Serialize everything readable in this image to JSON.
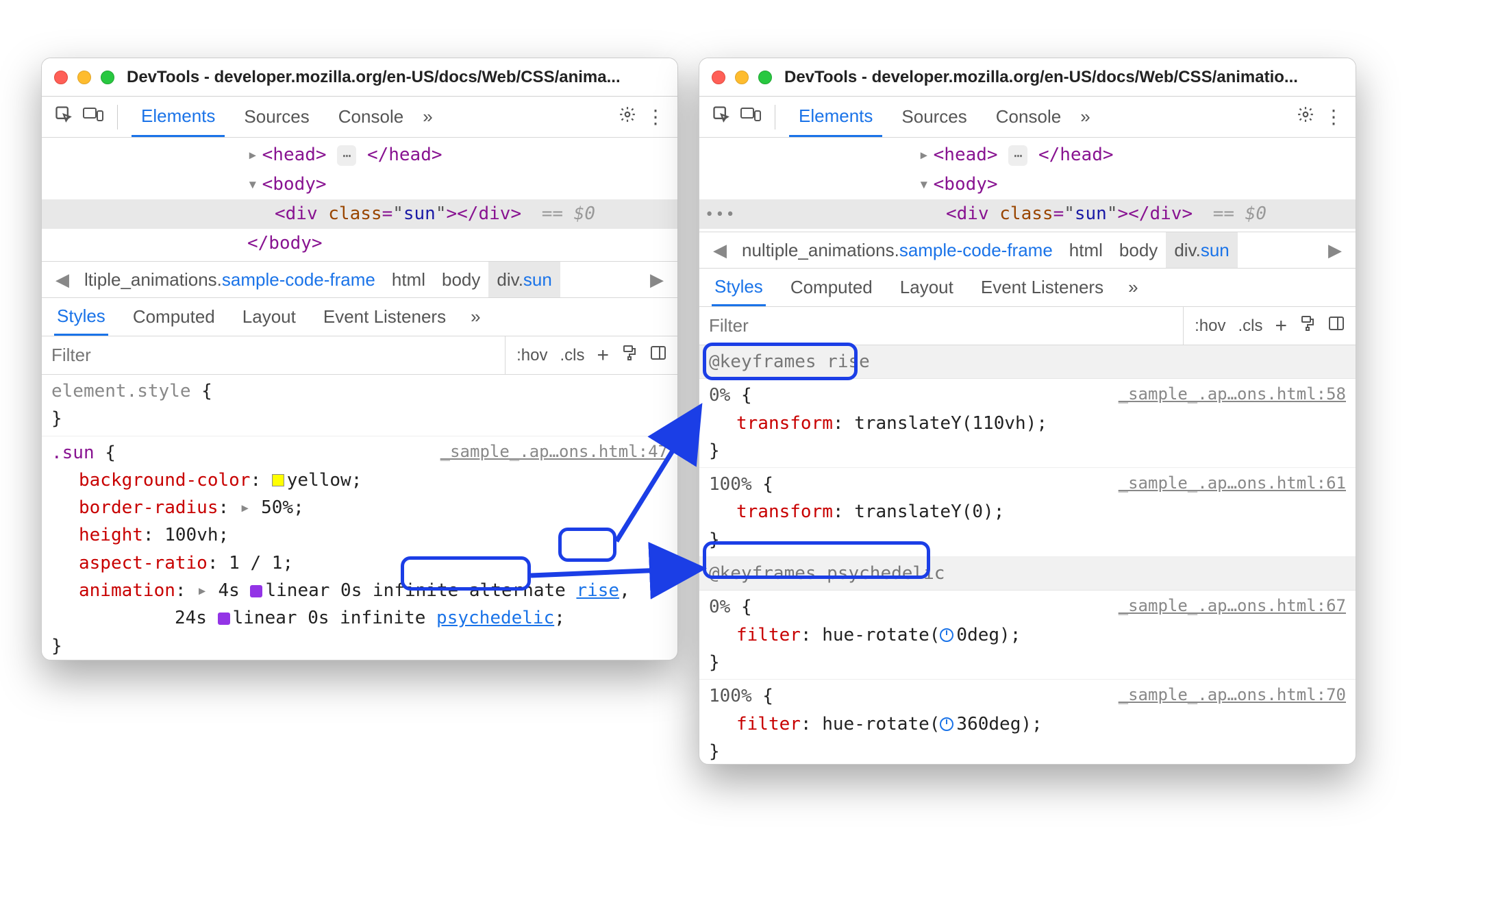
{
  "windowA": {
    "title": "DevTools - developer.mozilla.org/en-US/docs/Web/CSS/anima...",
    "tabs": {
      "elements": "Elements",
      "sources": "Sources",
      "console": "Console"
    },
    "dom": {
      "head_open": "<head>",
      "head_close": "</head>",
      "body_open": "<body>",
      "body_close": "</body>",
      "div_tag": "div",
      "div_class_attr": "class",
      "div_class_val": "sun",
      "eq": "== $0"
    },
    "crumbs": {
      "seg1a": "ltiple_animations.",
      "seg1b": "sample-code-frame",
      "seg2": "html",
      "seg3": "body",
      "seg4a": "div.",
      "seg4b": "sun"
    },
    "subtabs": {
      "styles": "Styles",
      "computed": "Computed",
      "layout": "Layout",
      "listeners": "Event Listeners"
    },
    "filter_placeholder": "Filter",
    "tools": {
      "hov": ":hov",
      "cls": ".cls"
    },
    "rules": {
      "element_style": "element.style",
      "sun_sel": ".sun",
      "sun_src": "_sample_.ap…ons.html:47",
      "props": {
        "bg": "background-color",
        "bg_v": "yellow",
        "br": "border-radius",
        "br_v": "50%",
        "h": "height",
        "h_v": "100vh",
        "ar": "aspect-ratio",
        "ar_v": "1 / 1",
        "anim": "animation",
        "anim_v1a": "4s ",
        "anim_v1b": "linear 0s infinite alternate ",
        "anim_v1_name": "rise",
        "anim_v2a": "24s ",
        "anim_v2b": "linear 0s infinite ",
        "anim_v2_name": "psychedelic"
      }
    }
  },
  "windowB": {
    "title": "DevTools - developer.mozilla.org/en-US/docs/Web/CSS/animatio...",
    "tabs": {
      "elements": "Elements",
      "sources": "Sources",
      "console": "Console"
    },
    "dom": {
      "head_open": "<head>",
      "head_close": "</head>",
      "body_open": "<body>",
      "body_close": "</body>",
      "div_tag": "div",
      "div_class_attr": "class",
      "div_class_val": "sun",
      "eq": "== $0"
    },
    "crumbs": {
      "seg1a": "nultiple_animations.",
      "seg1b": "sample-code-frame",
      "seg2": "html",
      "seg3": "body",
      "seg4a": "div.",
      "seg4b": "sun"
    },
    "subtabs": {
      "styles": "Styles",
      "computed": "Computed",
      "layout": "Layout",
      "listeners": "Event Listeners"
    },
    "filter_placeholder": "Filter",
    "tools": {
      "hov": ":hov",
      "cls": ".cls"
    },
    "kf": {
      "rise_head": "@keyframes rise",
      "rise0_src": "_sample_.ap…ons.html:58",
      "rise0_pct": "0%",
      "rise0_prop": "transform",
      "rise0_val": "translateY(110vh)",
      "rise100_src": "_sample_.ap…ons.html:61",
      "rise100_pct": "100%",
      "rise100_prop": "transform",
      "rise100_val": "translateY(0)",
      "psy_head": "@keyframes psychedelic",
      "psy0_src": "_sample_.ap…ons.html:67",
      "psy0_pct": "0%",
      "psy0_prop": "filter",
      "psy0_val_pre": "hue-rotate(",
      "psy0_val_deg": "0deg",
      "psy0_val_post": ")",
      "psy100_src": "_sample_.ap…ons.html:70",
      "psy100_pct": "100%",
      "psy100_prop": "filter",
      "psy100_val_pre": "hue-rotate(",
      "psy100_val_deg": "360deg",
      "psy100_val_post": ")"
    }
  }
}
